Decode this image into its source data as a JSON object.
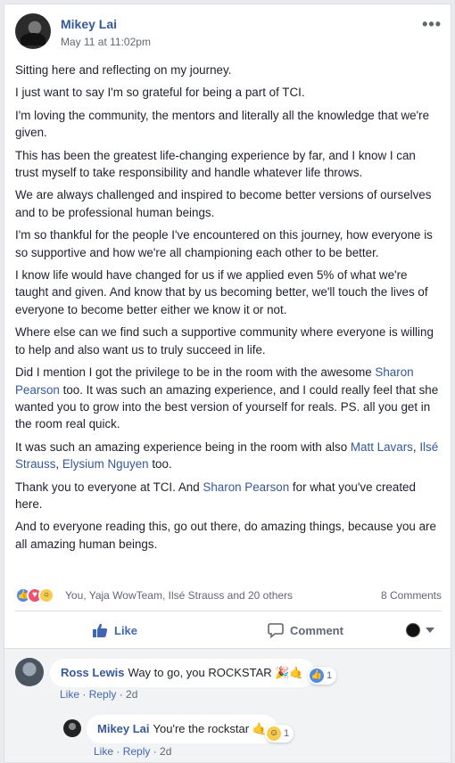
{
  "post": {
    "author": "Mikey Lai",
    "timestamp": "May 11 at 11:02pm",
    "more_label": "•••",
    "paragraphs": [
      "Sitting here and reflecting on my journey.",
      "I just want to say I'm so grateful for being a part of TCI.",
      "I'm loving the community, the mentors and literally all the knowledge that we're given.",
      "This has been the greatest life-changing experience by far, and I know I can trust myself to take responsibility and handle whatever life throws.",
      "We are always challenged and inspired to become better versions of ourselves and to be professional human beings.",
      "I'm so thankful for the people I've encountered on this journey, how everyone is so supportive and how we're all championing each other to be better.",
      "I know life would have changed for us if we applied even 5% of what we're taught and given. And know that by us becoming better, we'll touch the lives of everyone to become better either we know it or not.",
      "Where else can we find such a supportive community where everyone is willing to help and also want us to truly succeed in life."
    ],
    "p9": {
      "before": "Did I mention I got the privilege to be in the room with the awesome ",
      "link": "Sharon Pearson",
      "after": " too. It was such an amazing experience, and I could really feel that she wanted you to grow into the best version of yourself for reals. PS. all you get in the room real quick."
    },
    "p10": {
      "before": "It was such an amazing experience being in the room with also ",
      "link1": "Matt Lavars",
      "sep1": ", ",
      "link2": "Ilsé Strauss",
      "sep2": ", ",
      "link3": "Elysium Nguyen",
      "after": " too."
    },
    "p11": {
      "before": "Thank you to everyone at TCI. And ",
      "link": "Sharon Pearson",
      "after": " for what you've created here."
    },
    "p12": "And to everyone reading this, go out there, do amazing things, because you are all amazing human beings."
  },
  "reactions": {
    "names": "You, Yaja WowTeam, Ilsé Strauss and 20 others",
    "comments_count": "8 Comments",
    "icons": [
      "like-icon",
      "love-icon",
      "wow-icon"
    ]
  },
  "actions": {
    "like_label": "Like",
    "comment_label": "Comment"
  },
  "comments": [
    {
      "name": "Ross Lewis",
      "text": "Way to go, you ROCKSTAR 🎉🤙",
      "reaction_count": "1",
      "like_label": "Like",
      "reply_label": "Reply",
      "age": "2d"
    },
    {
      "name": "Mikey Lai",
      "text": "You're the rockstar 🤙",
      "reaction_count": "1",
      "like_label": "Like",
      "reply_label": "Reply",
      "age": "2d"
    }
  ],
  "colors": {
    "link": "#365899",
    "like_blue": "#4267b2",
    "secondary_text": "#616770",
    "background": "#e9ebee"
  }
}
